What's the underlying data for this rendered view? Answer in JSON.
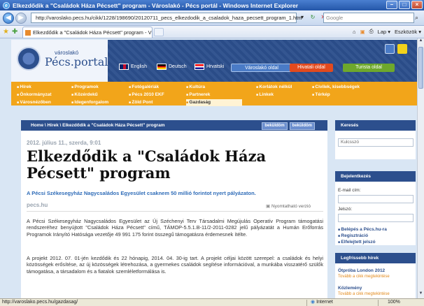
{
  "browser": {
    "window_title": "Elkezdődik a \"Családok Háza Pécsett\" program - Városlakó - Pécs portál - Windows Internet Explorer",
    "address_url": "http://varoslako.pecs.hu/cikk/1228/198690/20120711_pecs_elkezdodik_a_csaladok_haza_pecsett_program_1.htm",
    "search_placeholder": "Google",
    "tab_title": "Elkezdődik a \"Családok Háza Pécsett\" program - Váro...",
    "cmd_page": "Lap",
    "cmd_tools": "Eszközök",
    "status_url": "http://varoslako.pecs.hu/gazdasag/",
    "status_zone": "Internet",
    "status_zoom": "100%"
  },
  "site": {
    "logo_sub": "városlakó",
    "logo_main": "Pécs.portal",
    "langs": [
      "English",
      "Deutsch",
      "Hrvatski"
    ],
    "header_buttons": [
      "Városlakó oldal",
      "Hivatali oldal",
      "Turista oldal"
    ],
    "nav_columns": [
      [
        "Hírek",
        "Önkormányzat",
        "Városnézőben"
      ],
      [
        "Programok",
        "Közérdekű",
        "Idegenforgalom"
      ],
      [
        "Fotógalériák",
        "Pécs 2010 EKF",
        "Zöld Pont"
      ],
      [
        "Kultúra",
        "Partnerek",
        "Gazdaság"
      ],
      [
        "Korlátok nélkül",
        "Linkek"
      ],
      [
        "Civilek, kisebbségek",
        "Térkép"
      ]
    ],
    "nav_selected": "Gazdaság"
  },
  "article": {
    "breadcrumb": "Home \\ Hírek \\ Elkezdődik a \"Családok Háza Pécsett\" program",
    "bc_buttons": [
      "beküldöm",
      "beküldöm"
    ],
    "date": "2012. július 11., szerda, 9:01",
    "title": "Elkezdődik a \"Családok Háza Pécsett\" program",
    "lead": "A Pécsi Székesegyház Nagycsaládos Egyesület csaknem 50 millió forintot nyert pályázaton.",
    "source": "pecs.hu",
    "print_label": "Nyomtatható verzió",
    "paragraphs": [
      "A Pécsi Székesegyház Nagycsaládos Egyesület az Új Széchenyi Terv Társadalmi Megújulás Operatív Program támogatási rendszeréhez benyújtott \"Családok Háza Pécsett\" című, TÁMOP-5.5.1.B-11/2-2011-0282 jelű pályázatát a Humán Erőforrás Programok Irányító Hatósága vezetője 49 991 175 forint összegű támogatásra érdemesnek ítélte.",
      "A projekt 2012. 07. 01-jén kezdődik és 22 hónapig, 2014. 04. 30-ig tart. A projekt céljai között szerepel: a családok és helyi közösségek erősítése, az új közösségek létrehozása, a gyermekes családok segítése információval, a munkába visszatérő szülők támogatása, a társadalom és a fiatalok szemléletformálása is."
    ]
  },
  "sidebar": {
    "search_head": "Keresés",
    "search_value": "Kulcsszó",
    "login_head": "Bejelentkezés",
    "email_label": "E-mail cím:",
    "password_label": "Jelszó:",
    "links": [
      "Belépés a Pécs.hu-ra",
      "Regisztráció",
      "Elfelejtett jelszó"
    ],
    "news_head": "Legfrissebb hírek",
    "news": [
      {
        "title": "Ötpróba London 2012",
        "more": "Tovább a cikk megtekintése"
      },
      {
        "title": "Közlemény",
        "more": "Tovább a cikk megtekintése"
      }
    ]
  }
}
